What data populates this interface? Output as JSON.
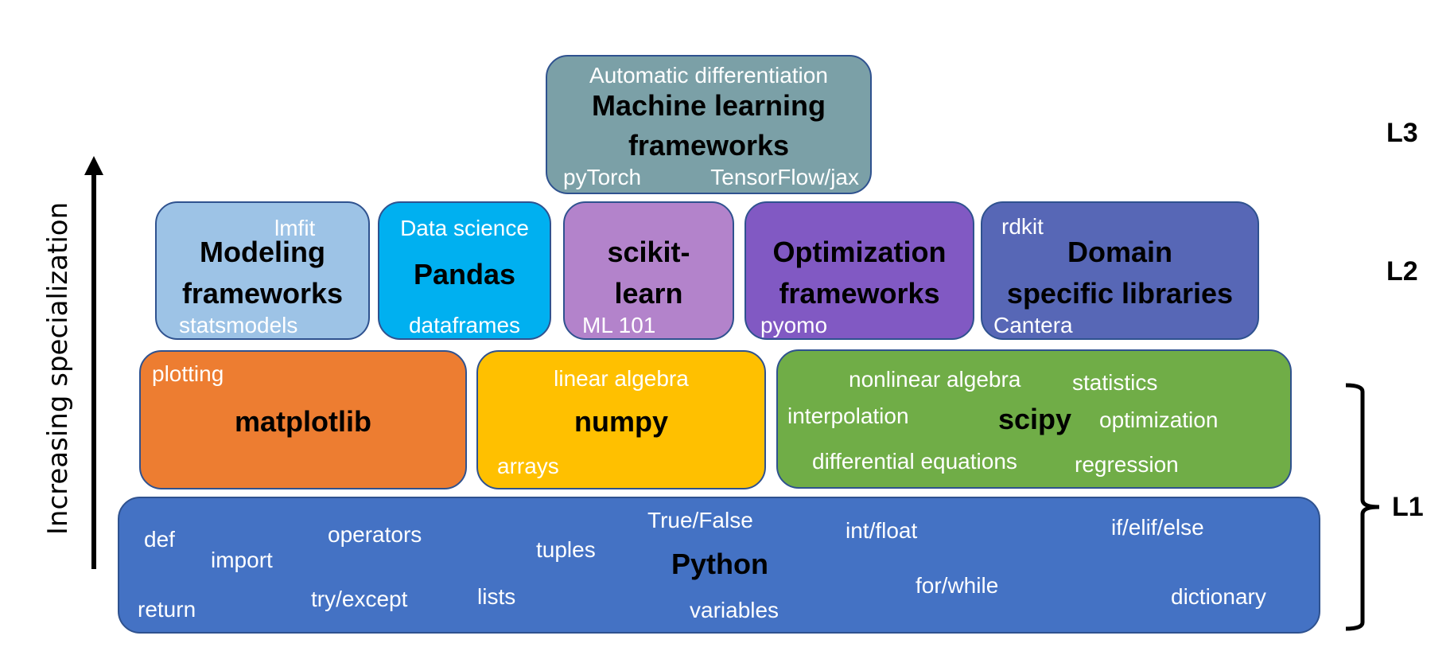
{
  "axis_label": "Increasing specialization",
  "levels": {
    "l3": "L3",
    "l2": "L2",
    "l1": "L1"
  },
  "colors": {
    "ml": "#7BA0A7",
    "modeling": "#9DC3E6",
    "pandas": "#00B0F0",
    "sklearn": "#B383CB",
    "optimization": "#8159C3",
    "domain": "#5767B6",
    "matplotlib": "#ED7D31",
    "numpy": "#FFC000",
    "scipy": "#70AD47",
    "python": "#4472C4"
  },
  "l3": {
    "ml": {
      "title_line1": "Machine learning",
      "title_line2": "frameworks",
      "top": "Automatic differentiation",
      "bottom_left": "pyTorch",
      "bottom_right": "TensorFlow/jax"
    }
  },
  "l2": {
    "modeling": {
      "title_line1": "Modeling",
      "title_line2": "frameworks",
      "top": "lmfit",
      "bottom": "statsmodels"
    },
    "pandas": {
      "title": "Pandas",
      "top": "Data science",
      "bottom": "dataframes"
    },
    "sklearn": {
      "title_line1": "scikit-",
      "title_line2": "learn",
      "bottom": "ML 101"
    },
    "optimization": {
      "title_line1": "Optimization",
      "title_line2": "frameworks",
      "bottom": "pyomo"
    },
    "domain": {
      "title_line1": "Domain",
      "title_line2": "specific libraries",
      "top": "rdkit",
      "bottom": "Cantera"
    }
  },
  "l1": {
    "matplotlib": {
      "title": "matplotlib",
      "top": "plotting"
    },
    "numpy": {
      "title": "numpy",
      "top": "linear algebra",
      "bottom": "arrays"
    },
    "scipy": {
      "title": "scipy",
      "keywords": [
        "nonlinear algebra",
        "statistics",
        "interpolation",
        "optimization",
        "differential equations",
        "regression"
      ]
    },
    "python": {
      "title": "Python",
      "keywords": [
        "def",
        "import",
        "operators",
        "tuples",
        "True/False",
        "int/float",
        "if/elif/else",
        "return",
        "try/except",
        "lists",
        "variables",
        "for/while",
        "dictionary"
      ]
    }
  }
}
